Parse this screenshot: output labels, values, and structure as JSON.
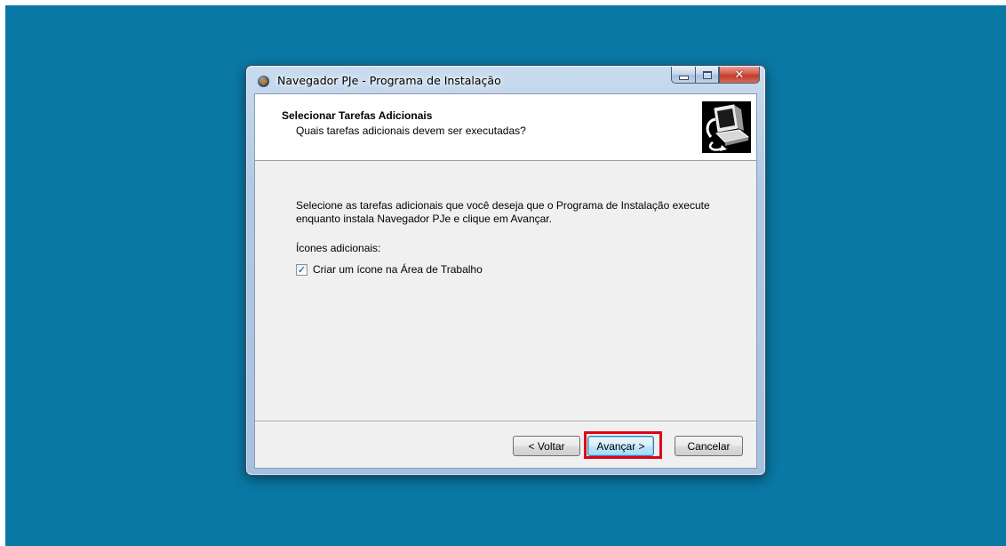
{
  "window": {
    "title": "Navegador PJe - Programa de Instalação",
    "close_glyph": "✕"
  },
  "header": {
    "title": "Selecionar Tarefas Adicionais",
    "subtitle": "Quais tarefas adicionais devem ser executadas?",
    "icon": "computer-install-icon"
  },
  "body": {
    "description": "Selecione as tarefas adicionais que você deseja que o Programa de Instalação execute enquanto instala Navegador PJe e clique em Avançar.",
    "section_label": "Ícones adicionais:",
    "checkbox_label": "Criar um ícone na Área de Trabalho",
    "checkbox_checked": true,
    "checkbox_glyph": "✓"
  },
  "buttons": {
    "back": "< Voltar",
    "next": "Avançar >",
    "cancel": "Cancelar"
  },
  "colors": {
    "desktop": "#0a78a5",
    "highlight": "#e2001a"
  }
}
